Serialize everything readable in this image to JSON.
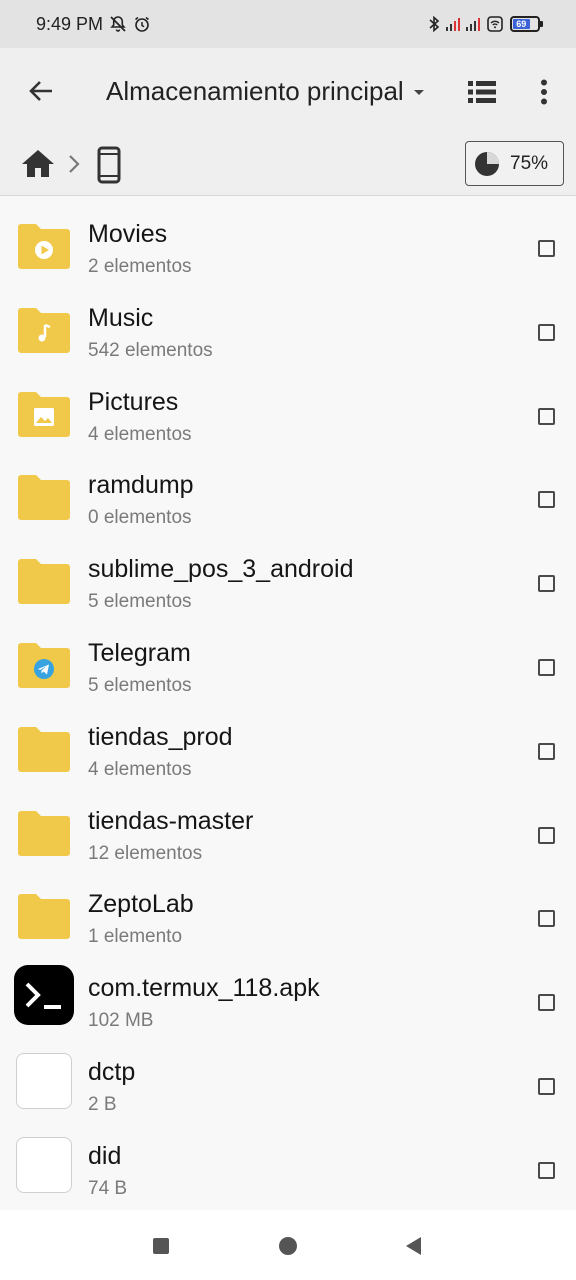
{
  "status_bar": {
    "time": "9:49 PM",
    "battery_level": "69",
    "colors": {
      "battery_fill": "#3b63d6"
    }
  },
  "app_bar": {
    "title": "Almacenamiento principal",
    "icons": {
      "back": "arrow-left-icon",
      "view": "list-view-icon",
      "more": "more-vert-icon",
      "dropdown": "caret-down-icon"
    }
  },
  "breadcrumb": {
    "icons": [
      "home-icon",
      "chevron-right-icon",
      "phone-icon"
    ],
    "storage_usage": "75%"
  },
  "files": [
    {
      "name": "Movies",
      "meta": "2 elementos",
      "icon": "folder-video-icon"
    },
    {
      "name": "Music",
      "meta": "542 elementos",
      "icon": "folder-music-icon"
    },
    {
      "name": "Pictures",
      "meta": "4 elementos",
      "icon": "folder-image-icon"
    },
    {
      "name": "ramdump",
      "meta": "0 elementos",
      "icon": "folder-icon"
    },
    {
      "name": "sublime_pos_3_android",
      "meta": "5 elementos",
      "icon": "folder-icon"
    },
    {
      "name": "Telegram",
      "meta": "5 elementos",
      "icon": "folder-telegram-icon"
    },
    {
      "name": "tiendas_prod",
      "meta": "4 elementos",
      "icon": "folder-icon"
    },
    {
      "name": "tiendas-master",
      "meta": "12 elementos",
      "icon": "folder-icon"
    },
    {
      "name": "ZeptoLab",
      "meta": "1 elemento",
      "icon": "folder-icon"
    },
    {
      "name": "com.termux_118.apk",
      "meta": "102 MB",
      "icon": "termux-app-icon"
    },
    {
      "name": "dctp",
      "meta": "2 B",
      "icon": "blank-file-icon"
    },
    {
      "name": "did",
      "meta": "74 B",
      "icon": "blank-file-icon"
    }
  ],
  "colors": {
    "folder": "#f0c94a",
    "folder_tab": "#e6bd3c",
    "telegram": "#37a3e0",
    "checkbox": "#4a4a4a"
  },
  "nav_bar": {
    "icons": [
      "recents-square-icon",
      "home-circle-icon",
      "back-triangle-icon"
    ]
  }
}
